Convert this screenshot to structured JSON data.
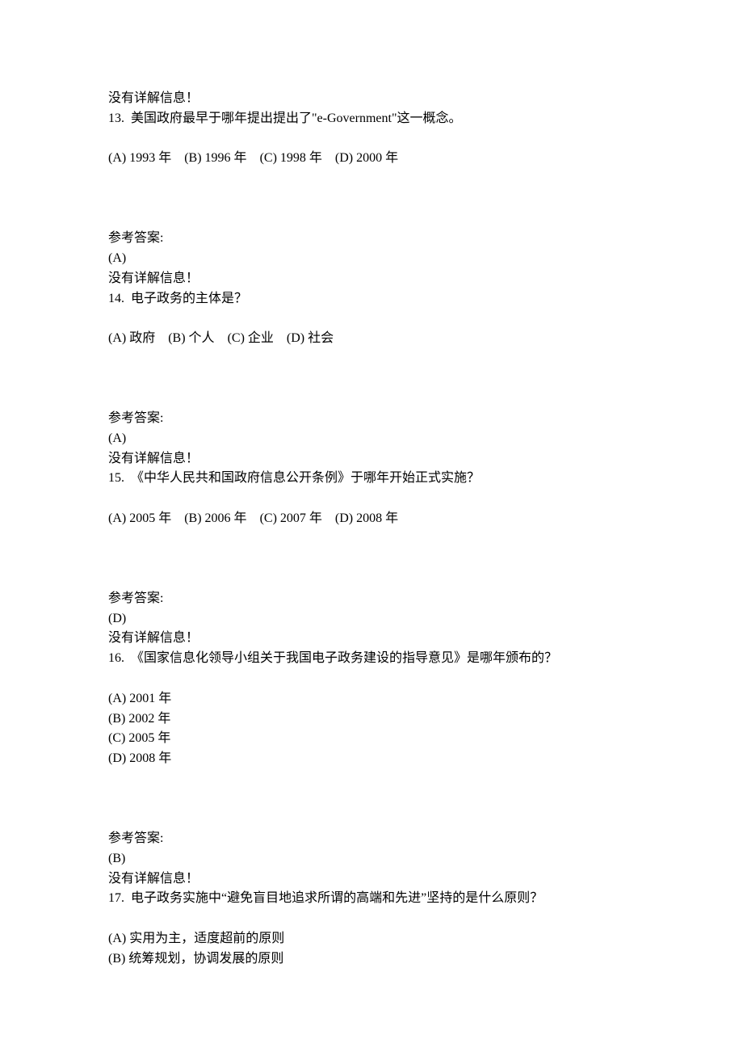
{
  "q12": {
    "noDetail": "没有详解信息！"
  },
  "q13": {
    "number": "13.",
    "question": "美国政府最早于哪年提出提出了\"e-Government\"这一概念。",
    "options": {
      "a": "(A) 1993 年",
      "b": "(B) 1996 年",
      "c": "(C) 1998 年",
      "d": "(D) 2000 年"
    },
    "answerLabel": "参考答案:",
    "answer": "(A)",
    "noDetail": "没有详解信息！"
  },
  "q14": {
    "number": "14.",
    "question": "电子政务的主体是？",
    "options": {
      "a": "(A) 政府",
      "b": "(B) 个人",
      "c": "(C) 企业",
      "d": "(D) 社会"
    },
    "answerLabel": "参考答案:",
    "answer": "(A)",
    "noDetail": "没有详解信息！"
  },
  "q15": {
    "number": "15.",
    "question": "《中华人民共和国政府信息公开条例》于哪年开始正式实施？",
    "options": {
      "a": "(A) 2005 年",
      "b": "(B) 2006 年",
      "c": "(C) 2007 年",
      "d": "(D) 2008 年"
    },
    "answerLabel": "参考答案:",
    "answer": "(D)",
    "noDetail": "没有详解信息！"
  },
  "q16": {
    "number": "16.",
    "question": "《国家信息化领导小组关于我国电子政务建设的指导意见》是哪年颁布的？",
    "options": {
      "a": "(A) 2001 年",
      "b": "(B) 2002 年",
      "c": "(C) 2005 年",
      "d": "(D) 2008 年"
    },
    "answerLabel": "参考答案:",
    "answer": "(B)",
    "noDetail": "没有详解信息！"
  },
  "q17": {
    "number": "17.",
    "question": "电子政务实施中“避免盲目地追求所谓的高端和先进”坚持的是什么原则？",
    "options": {
      "a": "(A) 实用为主，适度超前的原则",
      "b": "(B) 统筹规划，协调发展的原则"
    }
  }
}
